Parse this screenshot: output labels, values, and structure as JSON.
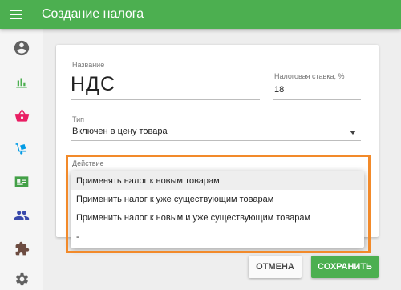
{
  "appbar": {
    "title": "Создание налога"
  },
  "sidebar": {
    "items": [
      {
        "icon": "account-circle-icon",
        "color": "#616161"
      },
      {
        "icon": "bar-chart-icon",
        "color": "#4caf50"
      },
      {
        "icon": "shopping-basket-icon",
        "color": "#e91e63"
      },
      {
        "icon": "dolly-icon",
        "color": "#039be5"
      },
      {
        "icon": "contact-card-icon",
        "color": "#43a047"
      },
      {
        "icon": "people-icon",
        "color": "#3949ab"
      },
      {
        "icon": "puzzle-icon",
        "color": "#6d4c41"
      },
      {
        "icon": "gear-icon",
        "color": "#616161"
      }
    ]
  },
  "form": {
    "name_label": "Название",
    "name_value": "НДС",
    "rate_label": "Налоговая ставка, %",
    "rate_value": "18",
    "type_label": "Тип",
    "type_value": "Включен в цену товара",
    "action_label": "Действие"
  },
  "dropdown": {
    "options": [
      "Применять налог к новым товарам",
      "Применить налог к уже существующим товарам",
      "Применить налог к новым и уже существующим товарам",
      "-"
    ],
    "active_index": 0
  },
  "buttons": {
    "cancel": "ОТМЕНА",
    "save": "СОХРАНИТЬ"
  },
  "colors": {
    "primary": "#4caf50",
    "highlight": "#f28a2a"
  }
}
